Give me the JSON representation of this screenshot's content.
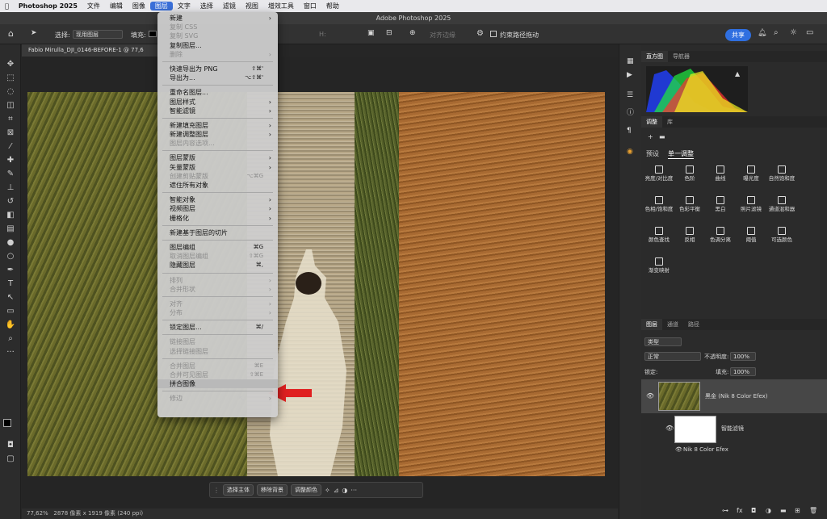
{
  "menubar": {
    "items": [
      "Photoshop 2025",
      "文件",
      "编辑",
      "图像",
      "图层",
      "文字",
      "选择",
      "滤镜",
      "视图",
      "增效工具",
      "窗口",
      "帮助"
    ]
  },
  "window": {
    "title": "Adobe Photoshop 2025"
  },
  "options": {
    "select_label": "选择:",
    "select_value": "现用图层",
    "fill_label": "填充:",
    "align_label": "对齐边缘",
    "constrain_label": "约束路径拖动",
    "share_label": "共享"
  },
  "document": {
    "tab_label": "Fabio Mirulla_DJI_0146-BEFORE-1 @ 77,6",
    "zoom": "77,62%",
    "info": "2878 像素 x 1919 像素 (240 ppi)"
  },
  "context_bar": {
    "select_subject": "选择主体",
    "remove_bg": "移除背景",
    "adjust_color": "调整颜色"
  },
  "layer_menu": {
    "items": [
      {
        "label": "新建",
        "arrow": true
      },
      {
        "label": "复制 CSS",
        "disabled": true
      },
      {
        "label": "复制 SVG",
        "disabled": true
      },
      {
        "label": "复制图层..."
      },
      {
        "label": "删除",
        "arrow": true,
        "disabled": true
      },
      {
        "sep": true
      },
      {
        "label": "快速导出为 PNG",
        "shortcut": "⇧⌘'"
      },
      {
        "label": "导出为...",
        "shortcut": "⌥⇧⌘'"
      },
      {
        "sep": true
      },
      {
        "label": "重命名图层..."
      },
      {
        "label": "图层样式",
        "arrow": true
      },
      {
        "label": "智能滤镜",
        "arrow": true
      },
      {
        "sep": true
      },
      {
        "label": "新建填充图层",
        "arrow": true
      },
      {
        "label": "新建调整图层",
        "arrow": true
      },
      {
        "label": "图层内容选项...",
        "disabled": true
      },
      {
        "sep": true
      },
      {
        "label": "图层蒙版",
        "arrow": true
      },
      {
        "label": "矢量蒙版",
        "arrow": true
      },
      {
        "label": "创建剪贴蒙版",
        "shortcut": "⌥⌘G",
        "disabled": true
      },
      {
        "label": "遮住所有对象"
      },
      {
        "sep": true
      },
      {
        "label": "智能对象",
        "arrow": true
      },
      {
        "label": "视频图层",
        "arrow": true
      },
      {
        "label": "栅格化",
        "arrow": true
      },
      {
        "sep": true
      },
      {
        "label": "新建基于图层的切片"
      },
      {
        "sep": true
      },
      {
        "label": "图层编组",
        "shortcut": "⌘G"
      },
      {
        "label": "取消图层编组",
        "shortcut": "⇧⌘G",
        "disabled": true
      },
      {
        "label": "隐藏图层",
        "shortcut": "⌘,"
      },
      {
        "sep": true
      },
      {
        "label": "排列",
        "arrow": true,
        "disabled": true
      },
      {
        "label": "合并形状",
        "arrow": true,
        "disabled": true
      },
      {
        "sep": true
      },
      {
        "label": "对齐",
        "arrow": true,
        "disabled": true
      },
      {
        "label": "分布",
        "arrow": true,
        "disabled": true
      },
      {
        "sep": true
      },
      {
        "label": "锁定图层...",
        "shortcut": "⌘/"
      },
      {
        "sep": true
      },
      {
        "label": "链接图层",
        "disabled": true
      },
      {
        "label": "选择链接图层",
        "disabled": true
      },
      {
        "sep": true
      },
      {
        "label": "合并图层",
        "shortcut": "⌘E",
        "disabled": true
      },
      {
        "label": "合并可见图层",
        "shortcut": "⇧⌘E",
        "disabled": true
      },
      {
        "label": "拼合图像",
        "highlight": true
      },
      {
        "sep": true
      },
      {
        "label": "修边",
        "arrow": true,
        "disabled": true
      }
    ]
  },
  "panels": {
    "histogram_tabs": [
      "直方图",
      "导航器"
    ],
    "adjust_tabs": [
      "调整",
      "库"
    ],
    "adjust_subtabs": [
      "预设",
      "单一调整"
    ],
    "adjustments": [
      "亮度/对比度",
      "色阶",
      "曲线",
      "曝光度",
      "自然饱和度",
      "色相/饱和度",
      "色彩平衡",
      "黑白",
      "照片滤镜",
      "通道混和器",
      "颜色查找",
      "反相",
      "色调分离",
      "阈值",
      "可选颜色",
      "渐变映射"
    ],
    "layer_tabs": [
      "图层",
      "通道",
      "路径"
    ],
    "kind_label": "类型",
    "blend_mode": "正常",
    "opacity_label": "不透明度:",
    "opacity_value": "100%",
    "lock_label": "锁定:",
    "fill_label": "填充:",
    "fill_value": "100%",
    "layer_name": "黑金 (Nik 8 Color Efex)",
    "smart_filter_label": "智能滤镜",
    "filter_name": "Nik 8 Color Efex"
  },
  "colors": {
    "accent": "#2f6fe0",
    "arrow": "#e02020"
  }
}
